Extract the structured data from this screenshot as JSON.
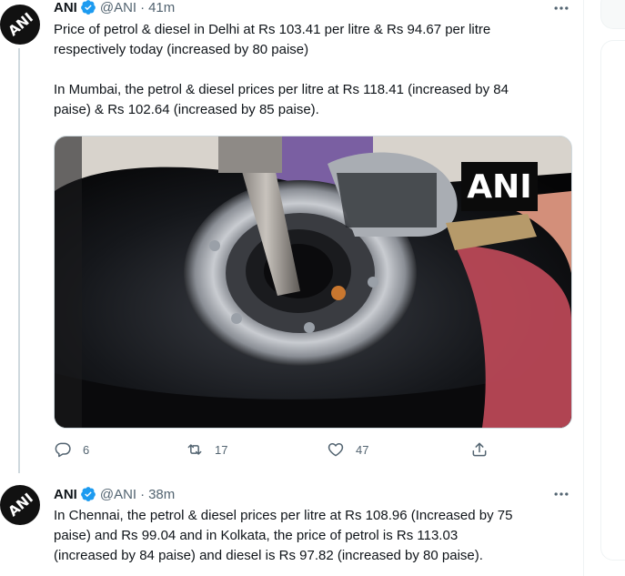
{
  "tweets": [
    {
      "author": "ANI",
      "handle": "@ANI",
      "separator": "·",
      "time": "41m",
      "avatar_text": "ANI",
      "text": "Price of petrol & diesel in Delhi at Rs 103.41 per litre & Rs 94.67 per litre\nrespectively today (increased by 80 paise)\n\nIn Mumbai, the petrol & diesel prices per litre at Rs 118.41 (increased by 84\npaise) & Rs 102.64 (increased by 85 paise).",
      "media_watermark": "ANI",
      "actions": {
        "replies": "6",
        "retweets": "17",
        "likes": "47"
      }
    },
    {
      "author": "ANI",
      "handle": "@ANI",
      "separator": "·",
      "time": "38m",
      "avatar_text": "ANI",
      "text": "In Chennai, the petrol & diesel prices per litre at Rs 108.96 (Increased by 75\npaise) and Rs 99.04 and in Kolkata, the price of petrol is Rs 113.03\n(increased by 84 paise) and diesel is Rs 97.82 (increased by 80 paise)."
    }
  ],
  "icons": {
    "verified": "verified-badge-icon",
    "more": "more-icon",
    "reply": "reply-icon",
    "retweet": "retweet-icon",
    "like": "like-icon",
    "share": "share-icon"
  },
  "colors": {
    "verified": "#1d9bf0",
    "secondary_text": "#536471",
    "thread_line": "#cfd9de"
  }
}
